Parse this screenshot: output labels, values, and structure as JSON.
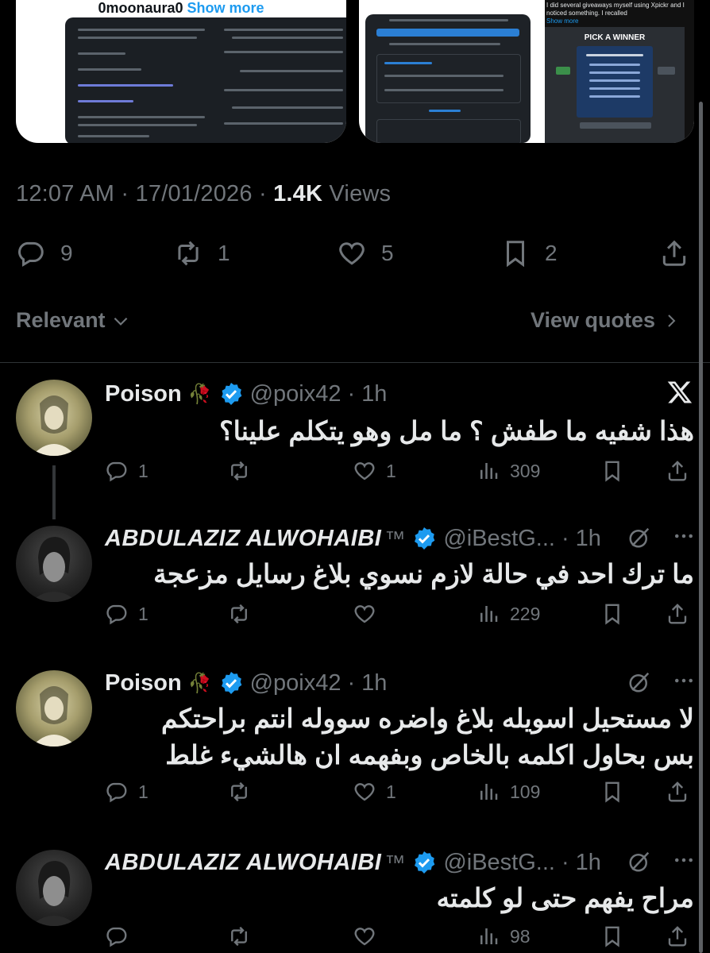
{
  "preview": {
    "left_title": "0moonaura0",
    "left_show_more": "Show more",
    "right_text": "I did several giveaways myself using Xpickr and I noticed something. I recalled",
    "right_show_more": "Show more",
    "pick_winner": "PICK A WINNER"
  },
  "post_meta": {
    "time": "12:07 AM",
    "date": "17/01/2026",
    "views_count": "1.4K",
    "views_label": "Views"
  },
  "post_stats": {
    "replies": "9",
    "reposts": "1",
    "likes": "5",
    "bookmarks": "2"
  },
  "sort": {
    "relevant_label": "Relevant",
    "view_quotes_label": "View quotes"
  },
  "replies": [
    {
      "name": "Poison",
      "handle": "@poix42",
      "time": "1h",
      "text": "هذا شفيه ما طفش ؟ ما مل وهو يتكلم علينا؟",
      "replies": "1",
      "reposts": "",
      "likes": "1",
      "views": "309"
    },
    {
      "name": "ABDULAZIZ ALWOHAIBI",
      "tm": "™",
      "handle": "@iBestG...",
      "time": "1h",
      "text": "ما ترك احد في حالة لازم نسوي بلاغ رسايل مزعجة",
      "replies": "1",
      "reposts": "",
      "likes": "",
      "views": "229"
    },
    {
      "name": "Poison",
      "handle": "@poix42",
      "time": "1h",
      "text_line1": "لا مستحيل اسويله بلاغ واضره سووله انتم براحتكم",
      "text_line2": "بس بحاول اكلمه بالخاص وبفهمه ان هالشيء غلط",
      "replies": "1",
      "reposts": "",
      "likes": "1",
      "views": "109"
    },
    {
      "name": "ABDULAZIZ ALWOHAIBI",
      "tm": "™",
      "handle": "@iBestG...",
      "time": "1h",
      "text": "مراح يفهم حتى لو كلمته",
      "replies": "",
      "reposts": "",
      "likes": "",
      "views": "98"
    }
  ],
  "colors": {
    "background": "#000000",
    "text": "#e7e9ea",
    "muted": "#71767b",
    "verified": "#1d9bf0",
    "divider": "#2f3336"
  }
}
